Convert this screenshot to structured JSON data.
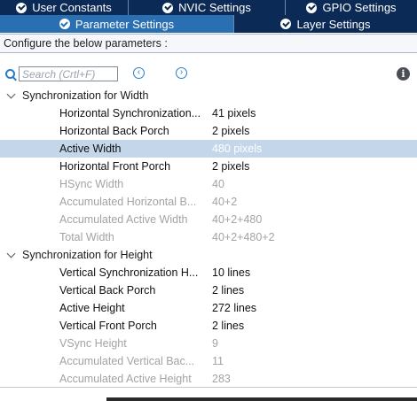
{
  "tabs_top": [
    {
      "label": "User Constants"
    },
    {
      "label": "NVIC Settings"
    },
    {
      "label": "GPIO Settings"
    }
  ],
  "tabs_main": [
    {
      "label": "Parameter Settings",
      "active": true
    },
    {
      "label": "Layer Settings",
      "active": false
    }
  ],
  "config_hint": "Configure the below parameters :",
  "search": {
    "placeholder": "Search (Crtl+F)",
    "value": ""
  },
  "groups": [
    {
      "title": "Synchronization for Width",
      "expanded": true,
      "params": [
        {
          "name": "Horizontal Synchronization...",
          "value": "41 pixels",
          "enabled": true
        },
        {
          "name": "Horizontal Back Porch",
          "value": "2 pixels",
          "enabled": true
        },
        {
          "name": "Active Width",
          "value": "480 pixels",
          "enabled": true,
          "selected": true
        },
        {
          "name": "Horizontal Front Porch",
          "value": "2 pixels",
          "enabled": true
        },
        {
          "name": "HSync Width",
          "value": "40",
          "enabled": false
        },
        {
          "name": "Accumulated Horizontal B...",
          "value": "40+2",
          "enabled": false
        },
        {
          "name": "Accumulated Active Width",
          "value": "40+2+480",
          "enabled": false
        },
        {
          "name": "Total Width",
          "value": "40+2+480+2",
          "enabled": false
        }
      ]
    },
    {
      "title": "Synchronization for Height",
      "expanded": true,
      "params": [
        {
          "name": "Vertical Synchronization H...",
          "value": "10 lines",
          "enabled": true
        },
        {
          "name": "Vertical Back Porch",
          "value": "2 lines",
          "enabled": true
        },
        {
          "name": "Active Height",
          "value": "272 lines",
          "enabled": true
        },
        {
          "name": "Vertical Front Porch",
          "value": "2 lines",
          "enabled": true
        },
        {
          "name": "VSync Height",
          "value": "9",
          "enabled": false
        },
        {
          "name": "Accumulated Vertical Bac...",
          "value": "11",
          "enabled": false
        },
        {
          "name": "Accumulated Active Height",
          "value": "283",
          "enabled": false
        }
      ]
    }
  ],
  "colors": {
    "tab_bar": "#0b2a55",
    "tab_active": "#2a6fb2",
    "row_selected": "#c3d6ea",
    "disabled_text": "#a3a3a3",
    "accent": "#2a7cc7"
  },
  "icons": {
    "tab_status": "check-circle-icon",
    "search": "search-icon",
    "prev": "arrow-left-circle-icon",
    "next": "arrow-right-circle-icon",
    "info": "info-icon",
    "group_toggle": "chevron-down-icon"
  }
}
